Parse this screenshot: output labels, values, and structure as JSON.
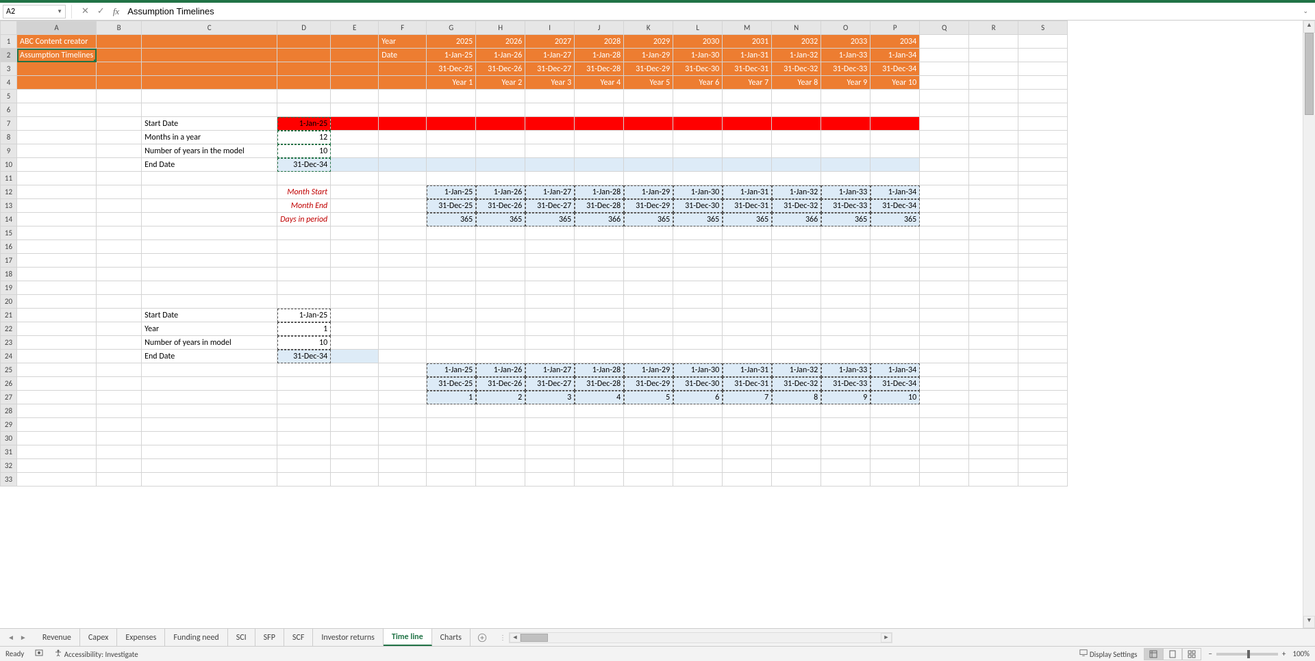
{
  "nameBox": "A2",
  "formula": "Assumption Timelines",
  "columns": [
    "A",
    "B",
    "C",
    "D",
    "E",
    "F",
    "G",
    "H",
    "I",
    "J",
    "K",
    "L",
    "M",
    "N",
    "O",
    "P",
    "Q",
    "R",
    "S"
  ],
  "header": {
    "title": "ABC Content creator",
    "subtitle": "Assumption Timelines",
    "yearLabel": "Year",
    "dateLabel": "Date",
    "years": [
      "2025",
      "2026",
      "2027",
      "2028",
      "2029",
      "2030",
      "2031",
      "2032",
      "2033",
      "2034"
    ],
    "startDates": [
      "1-Jan-25",
      "1-Jan-26",
      "1-Jan-27",
      "1-Jan-28",
      "1-Jan-29",
      "1-Jan-30",
      "1-Jan-31",
      "1-Jan-32",
      "1-Jan-33",
      "1-Jan-34"
    ],
    "endDates": [
      "31-Dec-25",
      "31-Dec-26",
      "31-Dec-27",
      "31-Dec-28",
      "31-Dec-29",
      "31-Dec-30",
      "31-Dec-31",
      "31-Dec-32",
      "31-Dec-33",
      "31-Dec-34"
    ],
    "yearLabels": [
      "Year 1",
      "Year 2",
      "Year 3",
      "Year 4",
      "Year 5",
      "Year 6",
      "Year 7",
      "Year 8",
      "Year 9",
      "Year 10"
    ]
  },
  "block1": {
    "startDateLabel": "Start Date",
    "startDate": "1-Jan-25",
    "monthsLabel": "Months in a year",
    "months": "12",
    "numYearsLabel": "Number of years in the model",
    "numYears": "10",
    "endDateLabel": "End Date",
    "endDate": "31-Dec-34"
  },
  "mid": {
    "monthStartLabel": "Month Start",
    "monthEndLabel": "Month End",
    "daysLabel": "Days in period",
    "monthStart": [
      "1-Jan-25",
      "1-Jan-26",
      "1-Jan-27",
      "1-Jan-28",
      "1-Jan-29",
      "1-Jan-30",
      "1-Jan-31",
      "1-Jan-32",
      "1-Jan-33",
      "1-Jan-34"
    ],
    "monthEnd": [
      "31-Dec-25",
      "31-Dec-26",
      "31-Dec-27",
      "31-Dec-28",
      "31-Dec-29",
      "31-Dec-30",
      "31-Dec-31",
      "31-Dec-32",
      "31-Dec-33",
      "31-Dec-34"
    ],
    "days": [
      "365",
      "365",
      "365",
      "366",
      "365",
      "365",
      "365",
      "366",
      "365",
      "365"
    ]
  },
  "block2": {
    "startDateLabel": "Start Date",
    "startDate": "1-Jan-25",
    "yearLabel": "Year",
    "year": "1",
    "numYearsLabel": "Number of years in model",
    "numYears": "10",
    "endDateLabel": "End Date",
    "endDate": "31-Dec-34"
  },
  "block3": {
    "r1": [
      "1-Jan-25",
      "1-Jan-26",
      "1-Jan-27",
      "1-Jan-28",
      "1-Jan-29",
      "1-Jan-30",
      "1-Jan-31",
      "1-Jan-32",
      "1-Jan-33",
      "1-Jan-34"
    ],
    "r2": [
      "31-Dec-25",
      "31-Dec-26",
      "31-Dec-27",
      "31-Dec-28",
      "31-Dec-29",
      "31-Dec-30",
      "31-Dec-31",
      "31-Dec-32",
      "31-Dec-33",
      "31-Dec-34"
    ],
    "r3": [
      "1",
      "2",
      "3",
      "4",
      "5",
      "6",
      "7",
      "8",
      "9",
      "10"
    ]
  },
  "tabs": [
    "Revenue",
    "Capex",
    "Expenses",
    "Funding need",
    "SCI",
    "SFP",
    "SCF",
    "Investor returns",
    "Time line",
    "Charts"
  ],
  "activeTab": "Time line",
  "status": {
    "ready": "Ready",
    "accessibility": "Accessibility: Investigate",
    "displaySettings": "Display Settings",
    "zoom": "100%"
  }
}
